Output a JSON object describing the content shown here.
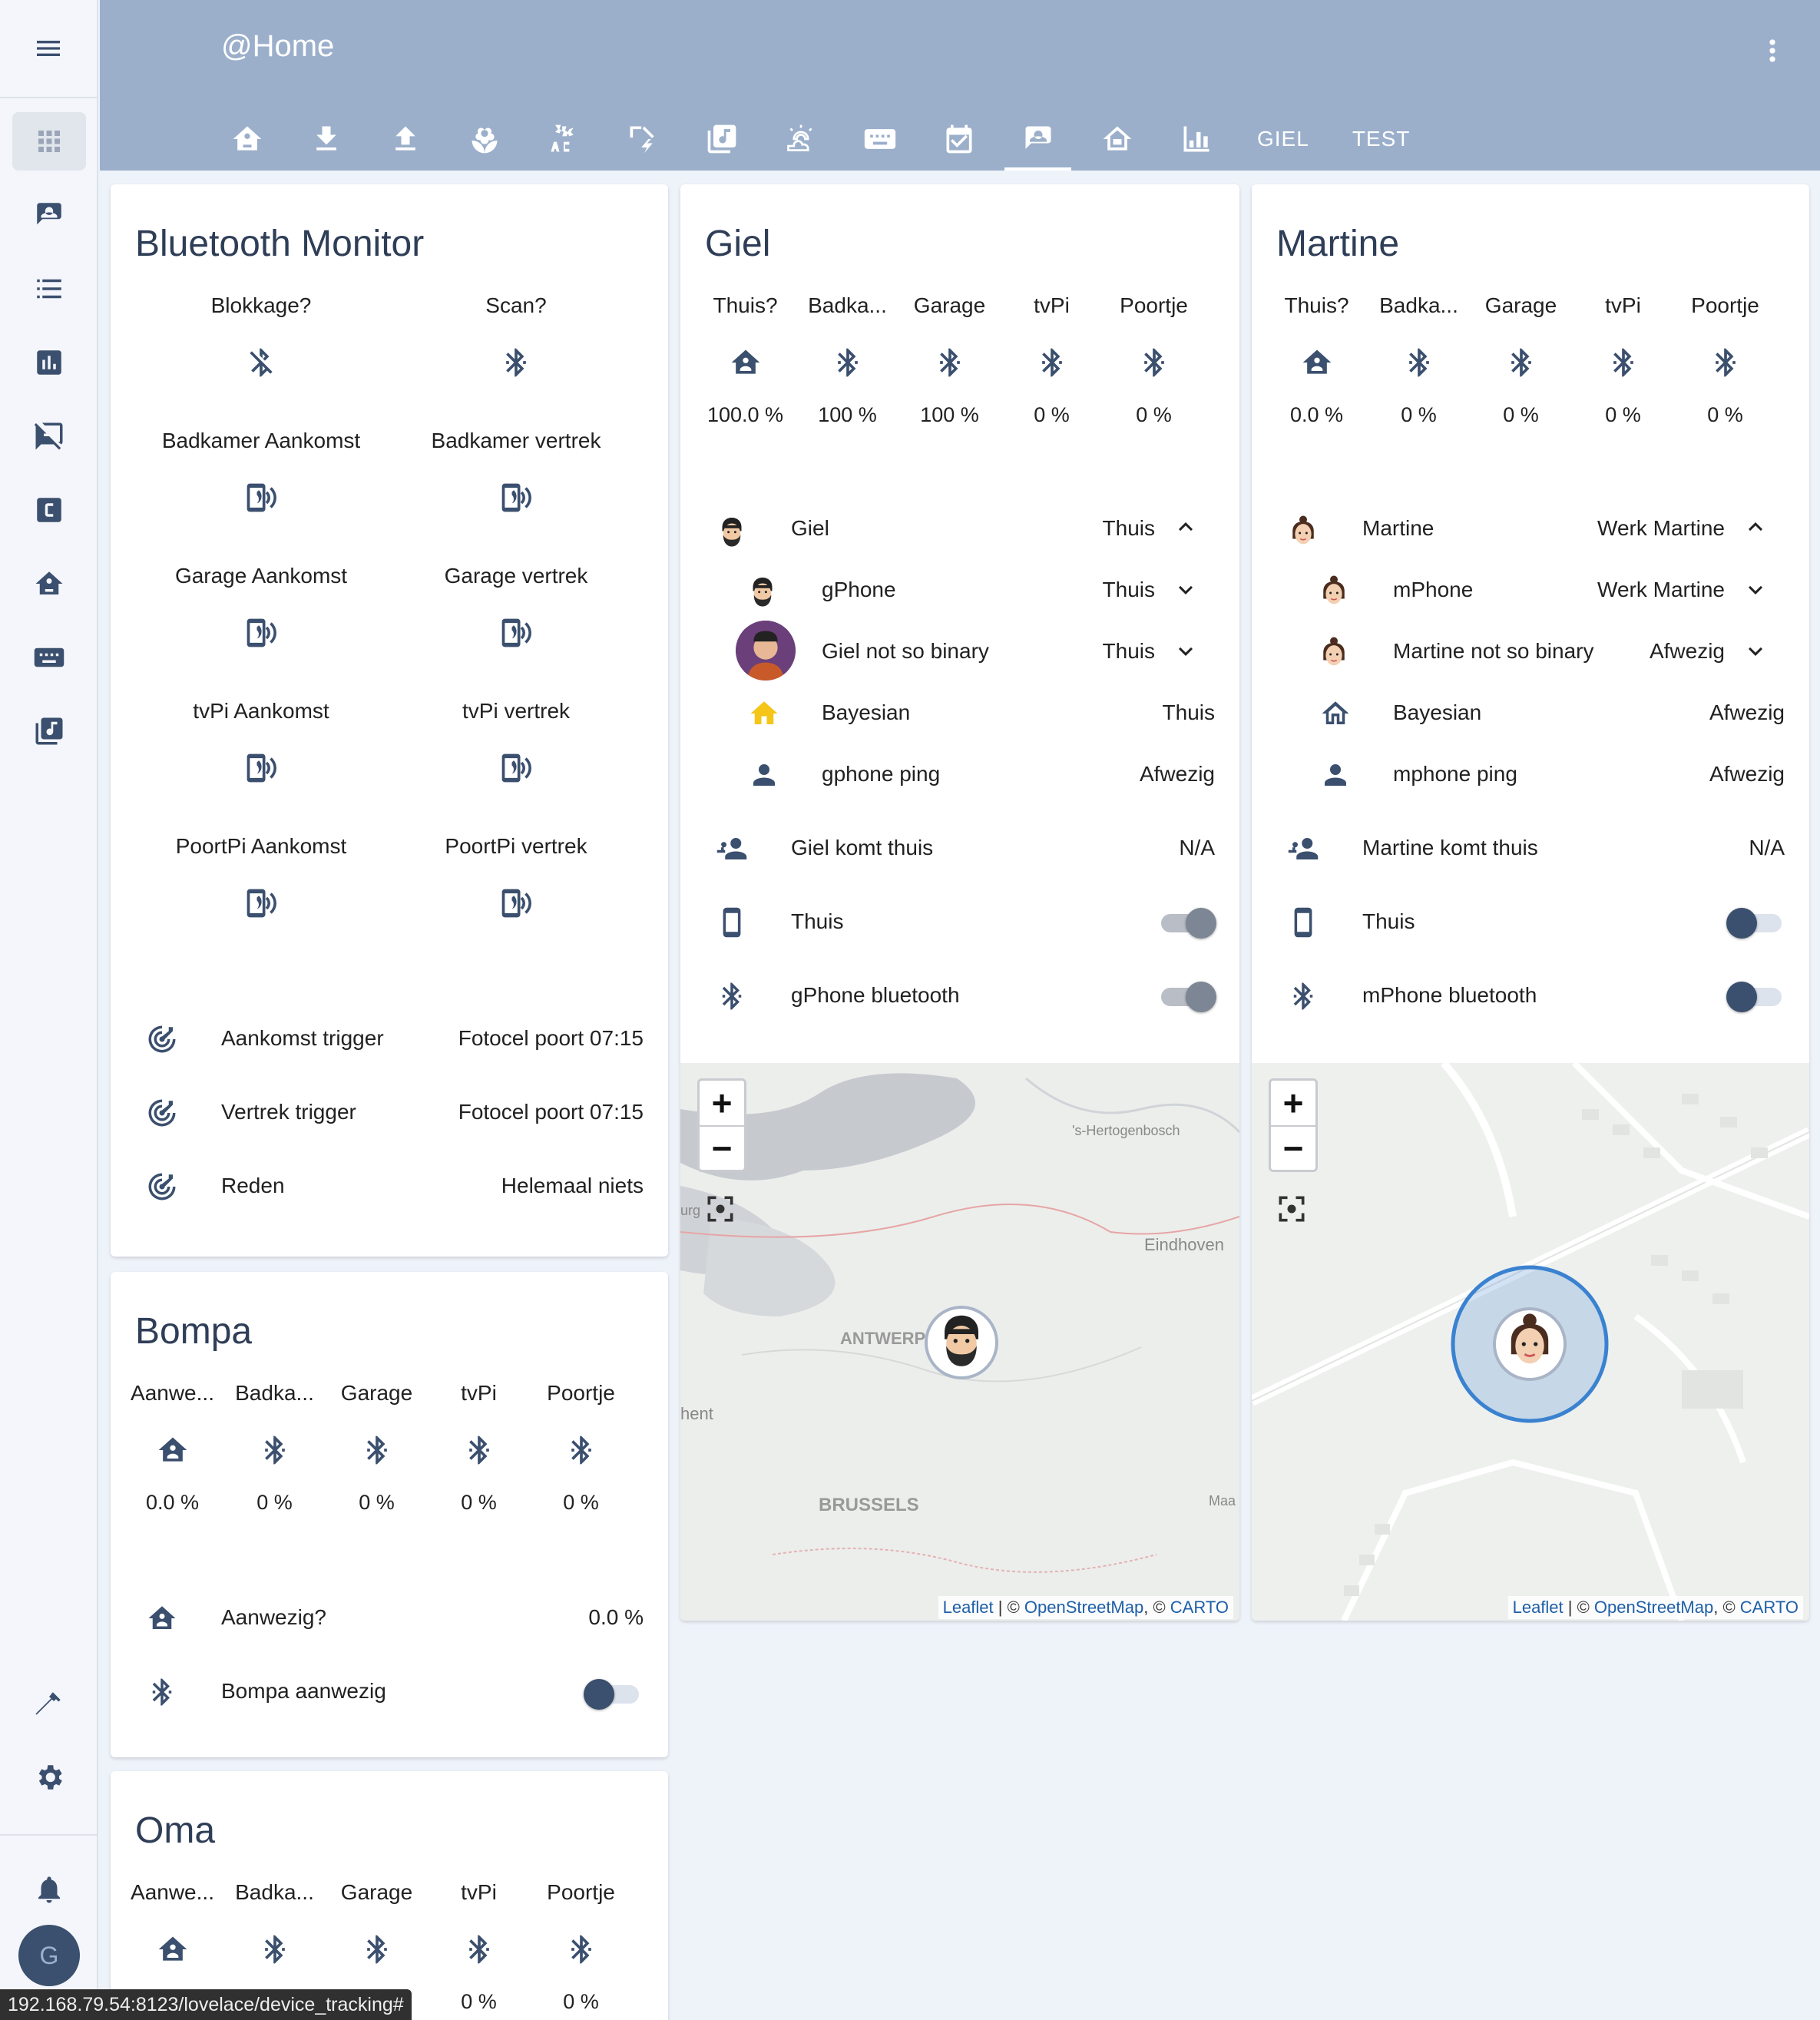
{
  "header": {
    "title": "@Home",
    "text_tabs": [
      "GIEL",
      "TEST"
    ]
  },
  "sidebar": {
    "avatar_initial": "G"
  },
  "bluetooth_monitor": {
    "title": "Bluetooth Monitor",
    "grid": [
      {
        "label": "Blokkage?",
        "icon": "bluetooth-off-icon"
      },
      {
        "label": "Scan?",
        "icon": "bluetooth-icon"
      },
      {
        "label": "Badkamer Aankomst",
        "icon": "cellphone-wireless-icon"
      },
      {
        "label": "Badkamer vertrek",
        "icon": "cellphone-wireless-icon"
      },
      {
        "label": "Garage Aankomst",
        "icon": "cellphone-wireless-icon"
      },
      {
        "label": "Garage vertrek",
        "icon": "cellphone-wireless-icon"
      },
      {
        "label": "tvPi Aankomst",
        "icon": "cellphone-wireless-icon"
      },
      {
        "label": "tvPi vertrek",
        "icon": "cellphone-wireless-icon"
      },
      {
        "label": "PoortPi Aankomst",
        "icon": "cellphone-wireless-icon"
      },
      {
        "label": "PoortPi vertrek",
        "icon": "cellphone-wireless-icon"
      }
    ],
    "rows": [
      {
        "name": "Aankomst trigger",
        "state": "Fotocel poort 07:15"
      },
      {
        "name": "Vertrek trigger",
        "state": "Fotocel poort 07:15"
      },
      {
        "name": "Reden",
        "state": "Helemaal niets"
      }
    ]
  },
  "giel": {
    "title": "Giel",
    "grid": [
      {
        "label": "Thuis?",
        "value": "100.0 %"
      },
      {
        "label": "Badka...",
        "value": "100 %"
      },
      {
        "label": "Garage",
        "value": "100 %"
      },
      {
        "label": "tvPi",
        "value": "0 %"
      },
      {
        "label": "Poortje",
        "value": "0 %"
      }
    ],
    "person": {
      "name": "Giel",
      "state": "Thuis"
    },
    "trackers": [
      {
        "name": "gPhone",
        "state": "Thuis"
      },
      {
        "name": "Giel not so binary",
        "state": "Thuis"
      },
      {
        "name": "Bayesian",
        "state": "Thuis"
      },
      {
        "name": "gphone ping",
        "state": "Afwezig"
      }
    ],
    "komt_thuis": {
      "name": "Giel komt thuis",
      "state": "N/A"
    },
    "toggles": [
      {
        "name": "Thuis",
        "on": true
      },
      {
        "name": "gPhone bluetooth",
        "on": true
      }
    ],
    "map_labels": {
      "city1": "'s-Hertogenbosch",
      "city2": "Eindhoven",
      "city3": "ANTWERP",
      "city4": "hent",
      "city5": "BRUSSELS",
      "city6": "Maa",
      "city7": "urg"
    },
    "attribution": {
      "leaflet": "Leaflet",
      "sep1": " | © ",
      "osm": "OpenStreetMap",
      "sep2": ", © ",
      "carto": "CARTO"
    }
  },
  "martine": {
    "title": "Martine",
    "grid": [
      {
        "label": "Thuis?",
        "value": "0.0 %"
      },
      {
        "label": "Badka...",
        "value": "0 %"
      },
      {
        "label": "Garage",
        "value": "0 %"
      },
      {
        "label": "tvPi",
        "value": "0 %"
      },
      {
        "label": "Poortje",
        "value": "0 %"
      }
    ],
    "person": {
      "name": "Martine",
      "state": "Werk Martine"
    },
    "trackers": [
      {
        "name": "mPhone",
        "state": "Werk Martine"
      },
      {
        "name": "Martine not so binary",
        "state": "Afwezig"
      },
      {
        "name": "Bayesian",
        "state": "Afwezig"
      },
      {
        "name": "mphone ping",
        "state": "Afwezig"
      }
    ],
    "komt_thuis": {
      "name": "Martine komt thuis",
      "state": "N/A"
    },
    "toggles": [
      {
        "name": "Thuis",
        "on": false
      },
      {
        "name": "mPhone bluetooth",
        "on": false
      }
    ],
    "attribution": {
      "leaflet": "Leaflet",
      "sep1": " | © ",
      "osm": "OpenStreetMap",
      "sep2": ", © ",
      "carto": "CARTO"
    }
  },
  "bompa": {
    "title": "Bompa",
    "grid": [
      {
        "label": "Aanwe...",
        "value": "0.0 %"
      },
      {
        "label": "Badka...",
        "value": "0 %"
      },
      {
        "label": "Garage",
        "value": "0 %"
      },
      {
        "label": "tvPi",
        "value": "0 %"
      },
      {
        "label": "Poortje",
        "value": "0 %"
      }
    ],
    "rows": [
      {
        "name": "Aanwezig?",
        "state": "0.0 %"
      },
      {
        "name": "Bompa aanwezig",
        "on": false
      }
    ]
  },
  "oma": {
    "title": "Oma",
    "grid": [
      {
        "label": "Aanwe...",
        "value": ""
      },
      {
        "label": "Badka...",
        "value": ""
      },
      {
        "label": "Garage",
        "value": ""
      },
      {
        "label": "tvPi",
        "value": "0 %"
      },
      {
        "label": "Poortje",
        "value": "0 %"
      }
    ]
  },
  "status_bar": {
    "url": "192.168.79.54:8123/lovelace/device_tracking#"
  }
}
